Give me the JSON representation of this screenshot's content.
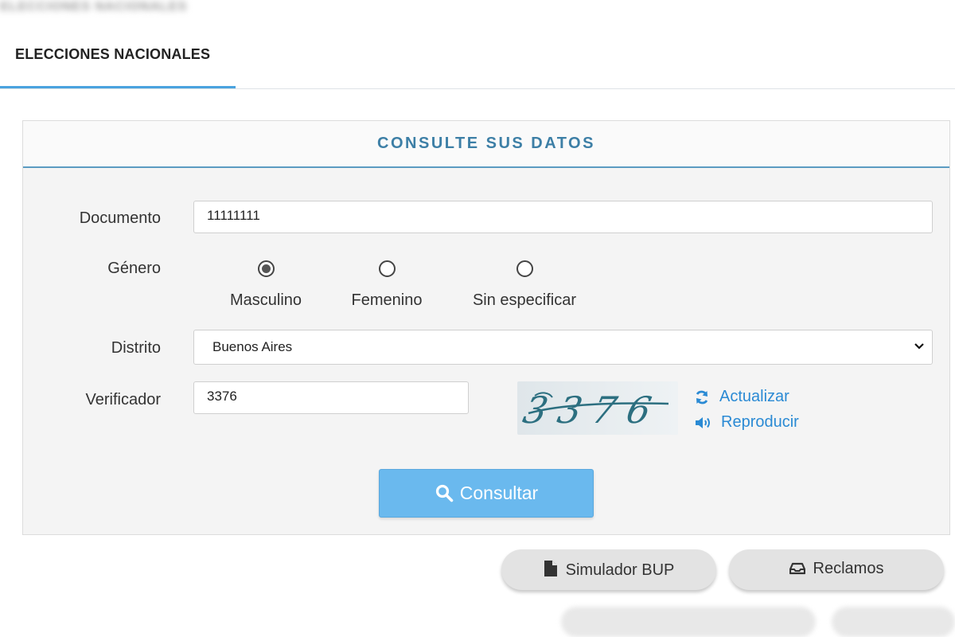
{
  "header": {
    "blurred_title": "ELECCIONES NACIONALES"
  },
  "tabs": [
    {
      "label": "ELECCIONES NACIONALES"
    }
  ],
  "form": {
    "title": "CONSULTE SUS DATOS",
    "documento": {
      "label": "Documento",
      "value": "11111111"
    },
    "genero": {
      "label": "Género",
      "options": [
        {
          "label": "Masculino",
          "checked": true
        },
        {
          "label": "Femenino",
          "checked": false
        },
        {
          "label": "Sin especificar",
          "checked": false
        }
      ]
    },
    "distrito": {
      "label": "Distrito",
      "value": "Buenos Aires"
    },
    "verificador": {
      "label": "Verificador",
      "value": "3376"
    },
    "captcha": {
      "text": "3376"
    },
    "actualizar_label": "Actualizar",
    "reproducir_label": "Reproducir",
    "consultar_label": "Consultar"
  },
  "footer_buttons": {
    "simulador_label": "Simulador BUP",
    "reclamos_label": "Reclamos"
  },
  "colors": {
    "accent": "#4aa3df",
    "title": "#3d7fa6",
    "primary_button": "#6ab9ee",
    "link": "#2a8ad4"
  }
}
